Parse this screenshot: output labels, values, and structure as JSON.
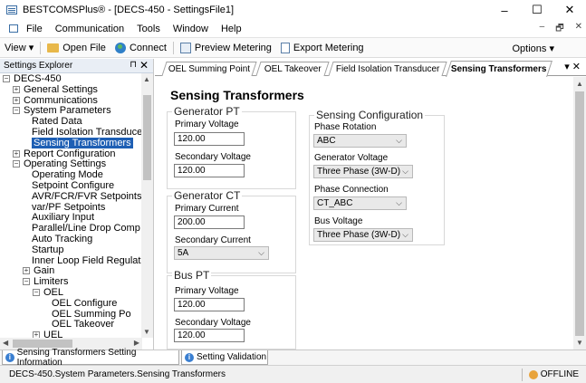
{
  "window": {
    "title": "BESTCOMSPlus® - [DECS-450 - SettingsFile1]",
    "minimize": "–",
    "maximize": "☐",
    "close": "✕"
  },
  "menubar": {
    "items": [
      "File",
      "Communication",
      "Tools",
      "Window",
      "Help"
    ],
    "mdi_min": "–",
    "mdi_restore": "🗗",
    "mdi_close": "✕"
  },
  "toolbar": {
    "view": "View ▾",
    "open_file": "Open File",
    "connect": "Connect",
    "preview_metering": "Preview Metering",
    "export_metering": "Export Metering",
    "options": "Options ▾"
  },
  "explorer": {
    "title": "Settings Explorer",
    "pin": "⊓",
    "close": "✕",
    "tree": [
      {
        "label": "DECS-450",
        "level": 0,
        "toggle": "−"
      },
      {
        "label": "General Settings",
        "level": 1,
        "toggle": "+"
      },
      {
        "label": "Communications",
        "level": 1,
        "toggle": "+"
      },
      {
        "label": "System Parameters",
        "level": 1,
        "toggle": "−"
      },
      {
        "label": "Rated Data",
        "level": 2,
        "toggle": ""
      },
      {
        "label": "Field Isolation Transduce",
        "level": 2,
        "toggle": ""
      },
      {
        "label": "Sensing Transformers",
        "level": 2,
        "toggle": "",
        "selected": true
      },
      {
        "label": "Report Configuration",
        "level": 1,
        "toggle": "+"
      },
      {
        "label": "Operating Settings",
        "level": 1,
        "toggle": "−"
      },
      {
        "label": "Operating Mode",
        "level": 2,
        "toggle": ""
      },
      {
        "label": "Setpoint Configure",
        "level": 2,
        "toggle": ""
      },
      {
        "label": "AVR/FCR/FVR Setpoints",
        "level": 2,
        "toggle": ""
      },
      {
        "label": "var/PF Setpoints",
        "level": 2,
        "toggle": ""
      },
      {
        "label": "Auxiliary Input",
        "level": 2,
        "toggle": ""
      },
      {
        "label": "Parallel/Line Drop Comp",
        "level": 2,
        "toggle": ""
      },
      {
        "label": "Auto Tracking",
        "level": 2,
        "toggle": ""
      },
      {
        "label": "Startup",
        "level": 2,
        "toggle": ""
      },
      {
        "label": "Inner Loop Field Regulat",
        "level": 2,
        "toggle": ""
      },
      {
        "label": "Gain",
        "level": 2,
        "toggle": "+"
      },
      {
        "label": "Limiters",
        "level": 2,
        "toggle": "−"
      },
      {
        "label": "OEL",
        "level": 3,
        "toggle": "−"
      },
      {
        "label": "OEL Configure",
        "level": 4,
        "toggle": ""
      },
      {
        "label": "OEL Summing Po",
        "level": 4,
        "toggle": ""
      },
      {
        "label": "OEL Takeover",
        "level": 4,
        "toggle": ""
      },
      {
        "label": "UEL",
        "level": 3,
        "toggle": "+"
      }
    ]
  },
  "tabs": [
    {
      "label": "OEL Summing Point",
      "active": false
    },
    {
      "label": "OEL Takeover",
      "active": false
    },
    {
      "label": "Field Isolation Transducer",
      "active": false
    },
    {
      "label": "Sensing Transformers",
      "active": true
    }
  ],
  "tabs_menu": "▾ ✕",
  "page": {
    "title": "Sensing Transformers",
    "generator_pt": {
      "title": "Generator PT",
      "primary_label": "Primary Voltage",
      "primary_value": "120.00",
      "secondary_label": "Secondary Voltage",
      "secondary_value": "120.00"
    },
    "generator_ct": {
      "title": "Generator CT",
      "primary_label": "Primary Current",
      "primary_value": "200.00",
      "secondary_label": "Secondary Current",
      "secondary_value": "5A"
    },
    "bus_pt": {
      "title": "Bus PT",
      "primary_label": "Primary Voltage",
      "primary_value": "120.00",
      "secondary_label": "Secondary Voltage",
      "secondary_value": "120.00"
    },
    "sensing_config": {
      "title": "Sensing Configuration",
      "phase_rotation_label": "Phase Rotation",
      "phase_rotation_value": "ABC",
      "gen_voltage_label": "Generator Voltage",
      "gen_voltage_value": "Three Phase (3W-D)",
      "phase_connection_label": "Phase Connection",
      "phase_connection_value": "CT_ABC",
      "bus_voltage_label": "Bus Voltage",
      "bus_voltage_value": "Three Phase (3W-D)"
    }
  },
  "bottom_tabs": [
    "Sensing Transformers Setting Information",
    "Setting Validation"
  ],
  "status": {
    "path": "DECS-450.System Parameters.Sensing Transformers",
    "connection": "OFFLINE"
  },
  "colors": {
    "selection": "#1e5fb4",
    "pane_header": "#e9eef5"
  }
}
